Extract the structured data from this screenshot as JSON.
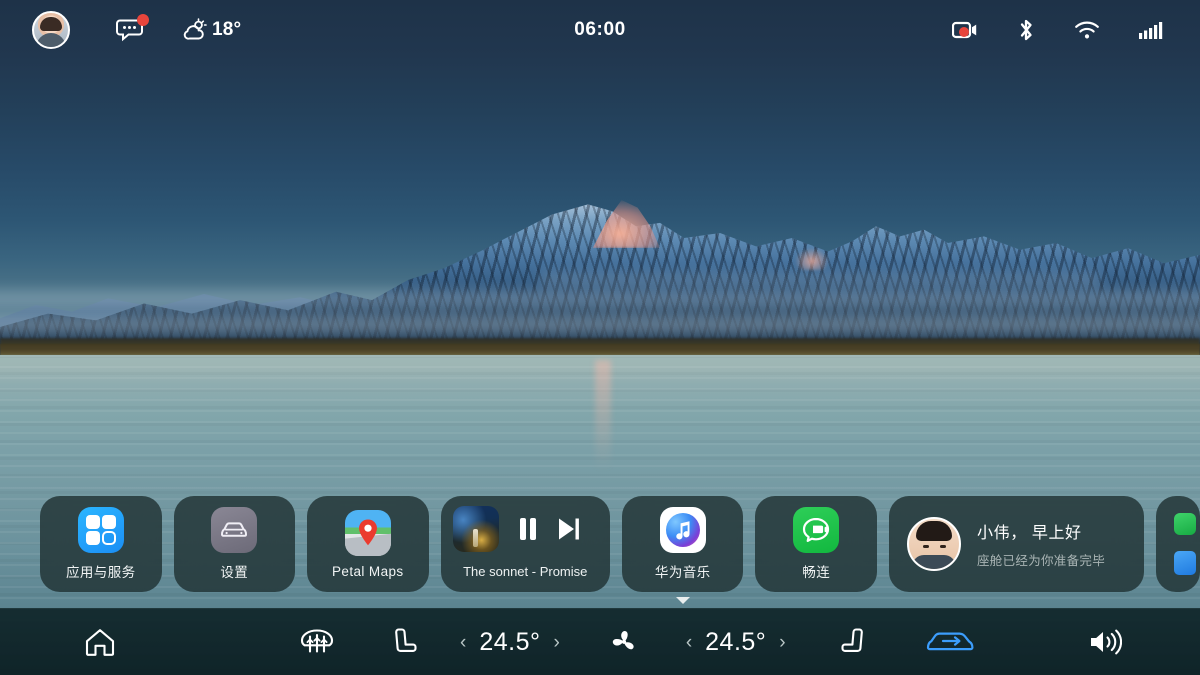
{
  "status_bar": {
    "avatar": "user-avatar",
    "messages_icon": "message-bubble-icon",
    "messages_badge": "",
    "weather_icon": "sun-behind-cloud-icon",
    "weather_temp": "18°",
    "clock": "06:00",
    "right_icons": [
      {
        "name": "dashcam-recording-icon",
        "label": "dashcam"
      },
      {
        "name": "bluetooth-icon",
        "label": "bluetooth"
      },
      {
        "name": "wifi-icon",
        "label": "wifi"
      },
      {
        "name": "cellular-signal-icon",
        "label": "signal"
      }
    ]
  },
  "dock": {
    "apps": {
      "label": "应用与服务",
      "icon": "app-grid-icon"
    },
    "settings": {
      "label": "设置",
      "icon": "car-settings-icon"
    },
    "maps": {
      "label": "Petal Maps",
      "icon": "map-pin-icon"
    },
    "media": {
      "title": "The sonnet - Promise",
      "pause_label": "pause",
      "next_label": "next"
    },
    "music": {
      "label": "华为音乐",
      "icon": "music-note-icon"
    },
    "meetime": {
      "label": "畅连",
      "icon": "video-call-icon"
    },
    "greeting": {
      "title": "小伟， 早上好",
      "subtitle": "座舱已经为你准备完毕"
    }
  },
  "climate_bar": {
    "home_label": "home",
    "rear_defrost_label": "rear-defrost",
    "driver_seat_label": "driver-seat-heat",
    "driver_temp": "24.5°",
    "fan_label": "fan",
    "passenger_temp": "24.5°",
    "passenger_seat_label": "passenger-seat-heat",
    "recirculation_label": "air-recirculation",
    "volume_label": "volume",
    "chevron_left": "‹",
    "chevron_right": "›"
  },
  "colors": {
    "accent_blue": "#3c9dfb",
    "badge_red": "#e8453c",
    "card_bg": "rgba(30,48,49,0.80)",
    "bar_bg": "#132a2e"
  }
}
